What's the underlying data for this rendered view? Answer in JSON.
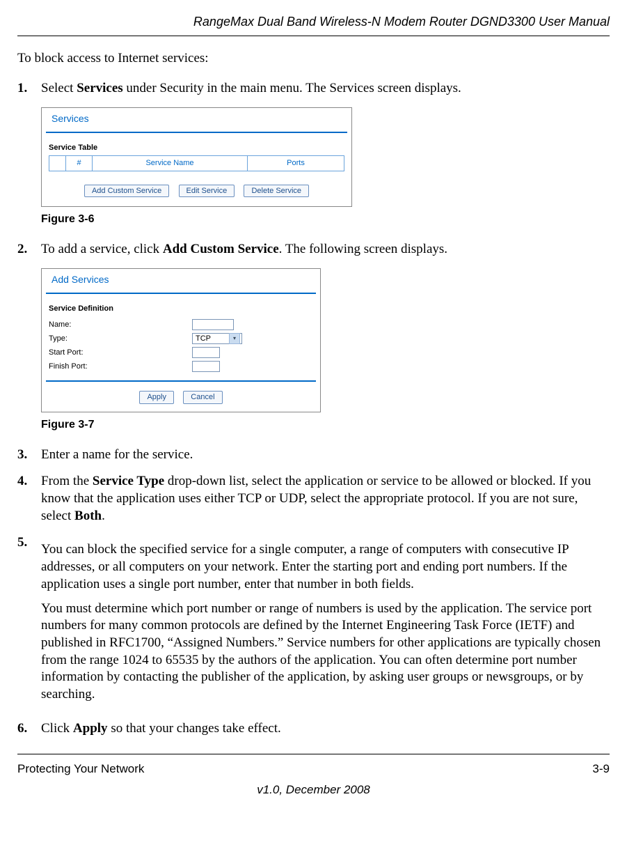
{
  "header": {
    "title": "RangeMax Dual Band Wireless-N Modem Router DGND3300 User Manual"
  },
  "intro": "To block access to Internet services:",
  "steps": {
    "s1": {
      "num": "1.",
      "pre": "Select ",
      "bold1": "Services",
      "post": " under Security in the main menu. The Services screen displays."
    },
    "s2": {
      "num": "2.",
      "pre": "To add a service, click ",
      "bold1": "Add Custom Service",
      "post": ". The following screen displays."
    },
    "s3": {
      "num": "3.",
      "text": "Enter a name for the service."
    },
    "s4": {
      "num": "4.",
      "pre": "From the ",
      "bold1": "Service Type",
      "mid": " drop-down list, select the application or service to be allowed or blocked. If you know that the application uses either TCP or UDP, select the appropriate protocol. If you are not sure, select ",
      "bold2": "Both",
      "post": "."
    },
    "s5": {
      "num": "5.",
      "p1": "You can block the specified service for a single computer, a range of computers with consecutive IP addresses, or all computers on your network. Enter the starting port and ending port numbers. If the application uses a single port number, enter that number in both fields.",
      "p2": "You must determine which port number or range of numbers is used by the application. The service port numbers for many common protocols are defined by the Internet Engineering Task Force (IETF) and published in RFC1700, “Assigned Numbers.” Service numbers for other applications are typically chosen from the range 1024 to 65535 by the authors of the application. You can often determine port number information by contacting the publisher of the application, by asking user groups or newsgroups, or by searching."
    },
    "s6": {
      "num": "6.",
      "pre": "Click ",
      "bold1": "Apply",
      "post": " so that your changes take effect."
    }
  },
  "figures": {
    "f6": "Figure 3-6",
    "f7": "Figure 3-7"
  },
  "services_panel": {
    "title": "Services",
    "sublabel": "Service Table",
    "columns": {
      "num": "#",
      "name": "Service Name",
      "ports": "Ports"
    },
    "buttons": {
      "add": "Add Custom Service",
      "edit": "Edit Service",
      "delete": "Delete Service"
    }
  },
  "add_services_panel": {
    "title": "Add Services",
    "sublabel": "Service Definition",
    "labels": {
      "name": "Name:",
      "type": "Type:",
      "start": "Start Port:",
      "finish": "Finish Port:"
    },
    "type_value": "TCP",
    "buttons": {
      "apply": "Apply",
      "cancel": "Cancel"
    }
  },
  "footer": {
    "section": "Protecting Your Network",
    "page": "3-9",
    "version": "v1.0, December 2008"
  }
}
